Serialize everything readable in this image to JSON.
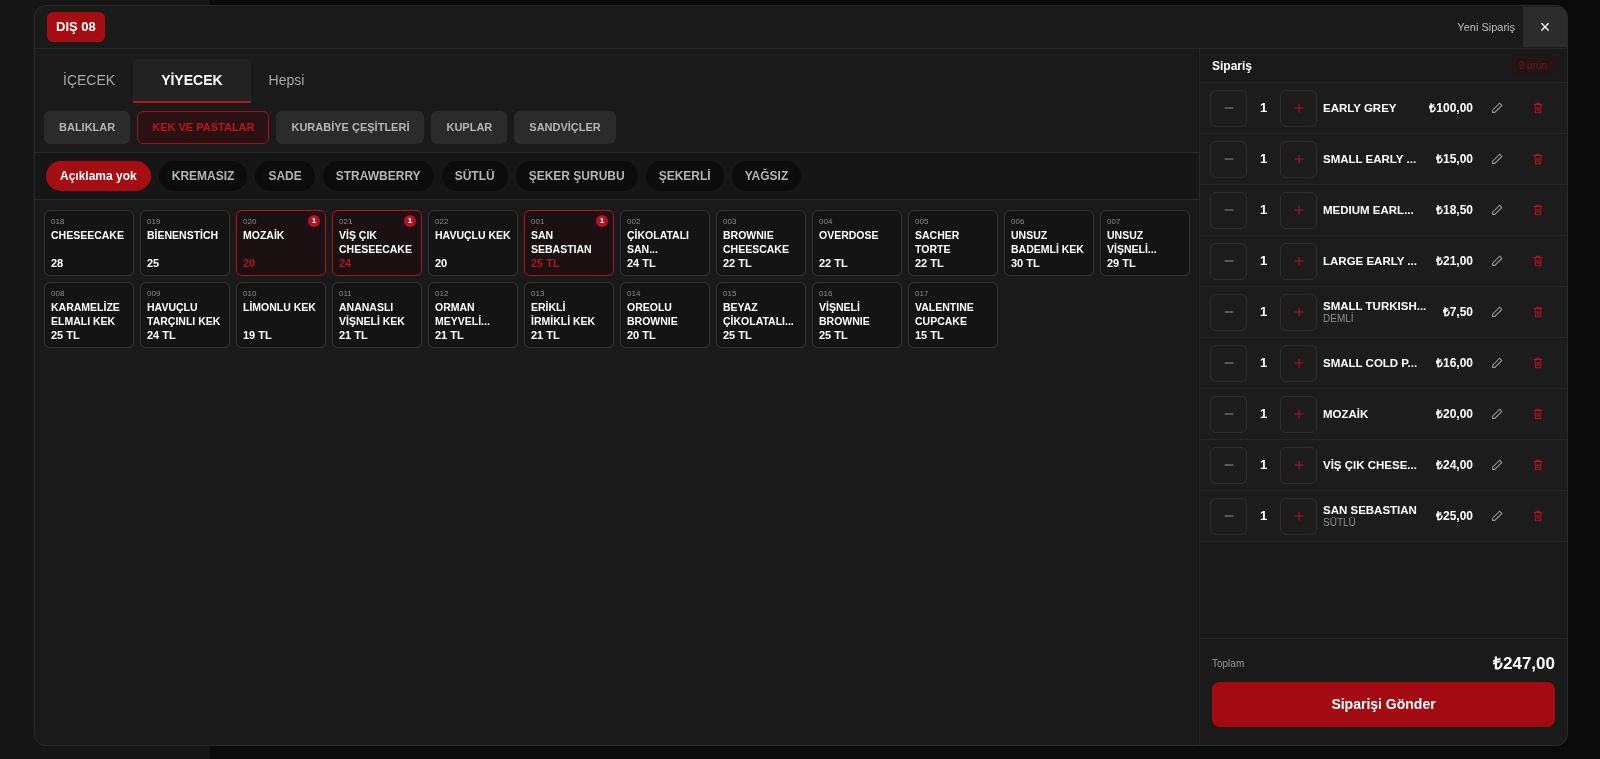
{
  "header": {
    "table_badge": "DIŞ 08",
    "title": "Yeni Sipariş",
    "close": "×"
  },
  "tabs": [
    {
      "label": "İÇECEK",
      "selected": false
    },
    {
      "label": "YİYECEK",
      "selected": true
    },
    {
      "label": "Hepsi",
      "selected": false
    }
  ],
  "categories": [
    {
      "label": "BALIKLAR",
      "selected": false
    },
    {
      "label": "KEK VE PASTALAR",
      "selected": true
    },
    {
      "label": "KURABİYE ÇEŞİTLERİ",
      "selected": false
    },
    {
      "label": "KUPLAR",
      "selected": false
    },
    {
      "label": "SANDVİÇLER",
      "selected": false
    }
  ],
  "options": [
    {
      "label": "Açıklama yok",
      "selected": true
    },
    {
      "label": "KREMASIZ",
      "selected": false
    },
    {
      "label": "SADE",
      "selected": false
    },
    {
      "label": "STRAWBERRY",
      "selected": false
    },
    {
      "label": "SÜTLÜ",
      "selected": false
    },
    {
      "label": "ŞEKER ŞURUBU",
      "selected": false
    },
    {
      "label": "ŞEKERLİ",
      "selected": false
    },
    {
      "label": "YAĞSIZ",
      "selected": false
    }
  ],
  "products": [
    {
      "code": "018",
      "name": "CHESEECAKE",
      "price": "28",
      "selected": false
    },
    {
      "code": "019",
      "name": "BİENENSTİCH",
      "price": "25",
      "selected": false
    },
    {
      "code": "020",
      "name": "MOZAİK",
      "price": "20",
      "selected": true,
      "count": "1"
    },
    {
      "code": "021",
      "name": "VİŞ ÇIK CHESEECAKE",
      "price": "24",
      "selected": true,
      "count": "1"
    },
    {
      "code": "022",
      "name": "HAVUÇLU KEK",
      "price": "20",
      "selected": false
    },
    {
      "code": "001",
      "name": "SAN SEBASTIAN",
      "price": "25 TL",
      "selected": true,
      "count": "1"
    },
    {
      "code": "002",
      "name": "ÇİKOLATALI SAN...",
      "price": "24 TL",
      "selected": false
    },
    {
      "code": "003",
      "name": "BROWNIE CHEESCAKE",
      "price": "22 TL",
      "selected": false
    },
    {
      "code": "004",
      "name": "OVERDOSE",
      "price": "22 TL",
      "selected": false
    },
    {
      "code": "005",
      "name": "SACHER TORTE",
      "price": "22 TL",
      "selected": false
    },
    {
      "code": "006",
      "name": "UNSUZ BADEMLİ KEK",
      "price": "30 TL",
      "selected": false
    },
    {
      "code": "007",
      "name": "UNSUZ VİŞNELİ...",
      "price": "29 TL",
      "selected": false
    },
    {
      "code": "008",
      "name": "KARAMELİZE ELMALI KEK",
      "price": "25 TL",
      "selected": false
    },
    {
      "code": "009",
      "name": "HAVUÇLU TARÇINLI KEK",
      "price": "24 TL",
      "selected": false
    },
    {
      "code": "010",
      "name": "LİMONLU KEK",
      "price": "19 TL",
      "selected": false
    },
    {
      "code": "011",
      "name": "ANANASLI VİŞNELİ KEK",
      "price": "21 TL",
      "selected": false
    },
    {
      "code": "012",
      "name": "ORMAN MEYVELİ...",
      "price": "21 TL",
      "selected": false
    },
    {
      "code": "013",
      "name": "ERİKLİ İRMİKLİ KEK",
      "price": "21 TL",
      "selected": false
    },
    {
      "code": "014",
      "name": "OREOLU BROWNIE",
      "price": "20 TL",
      "selected": false
    },
    {
      "code": "015",
      "name": "BEYAZ ÇİKOLATALI...",
      "price": "25 TL",
      "selected": false
    },
    {
      "code": "016",
      "name": "VİŞNELİ BROWNIE",
      "price": "25 TL",
      "selected": false
    },
    {
      "code": "017",
      "name": "VALENTINE CUPCAKE",
      "price": "15 TL",
      "selected": false
    }
  ],
  "order": {
    "title": "Sipariş",
    "count": "9 ürün",
    "items": [
      {
        "qty": "1",
        "name": "EARLY GREY",
        "price": "₺100,00"
      },
      {
        "qty": "1",
        "name": "SMALL EARLY ...",
        "price": "₺15,00"
      },
      {
        "qty": "1",
        "name": "MEDIUM EARL...",
        "price": "₺18,50"
      },
      {
        "qty": "1",
        "name": "LARGE EARLY ...",
        "price": "₺21,00"
      },
      {
        "qty": "1",
        "name": "SMALL TURKISH...",
        "note": "DEMLİ",
        "price": "₺7,50"
      },
      {
        "qty": "1",
        "name": "SMALL COLD P...",
        "price": "₺16,00"
      },
      {
        "qty": "1",
        "name": "MOZAİK",
        "price": "₺20,00"
      },
      {
        "qty": "1",
        "name": "VİŞ ÇIK CHESE...",
        "price": "₺24,00"
      },
      {
        "qty": "1",
        "name": "SAN SEBASTIAN",
        "note": "SÜTLÜ",
        "price": "₺25,00"
      }
    ],
    "total_label": "Toplam",
    "total": "₺247,00",
    "submit": "Siparişi Gönder"
  }
}
